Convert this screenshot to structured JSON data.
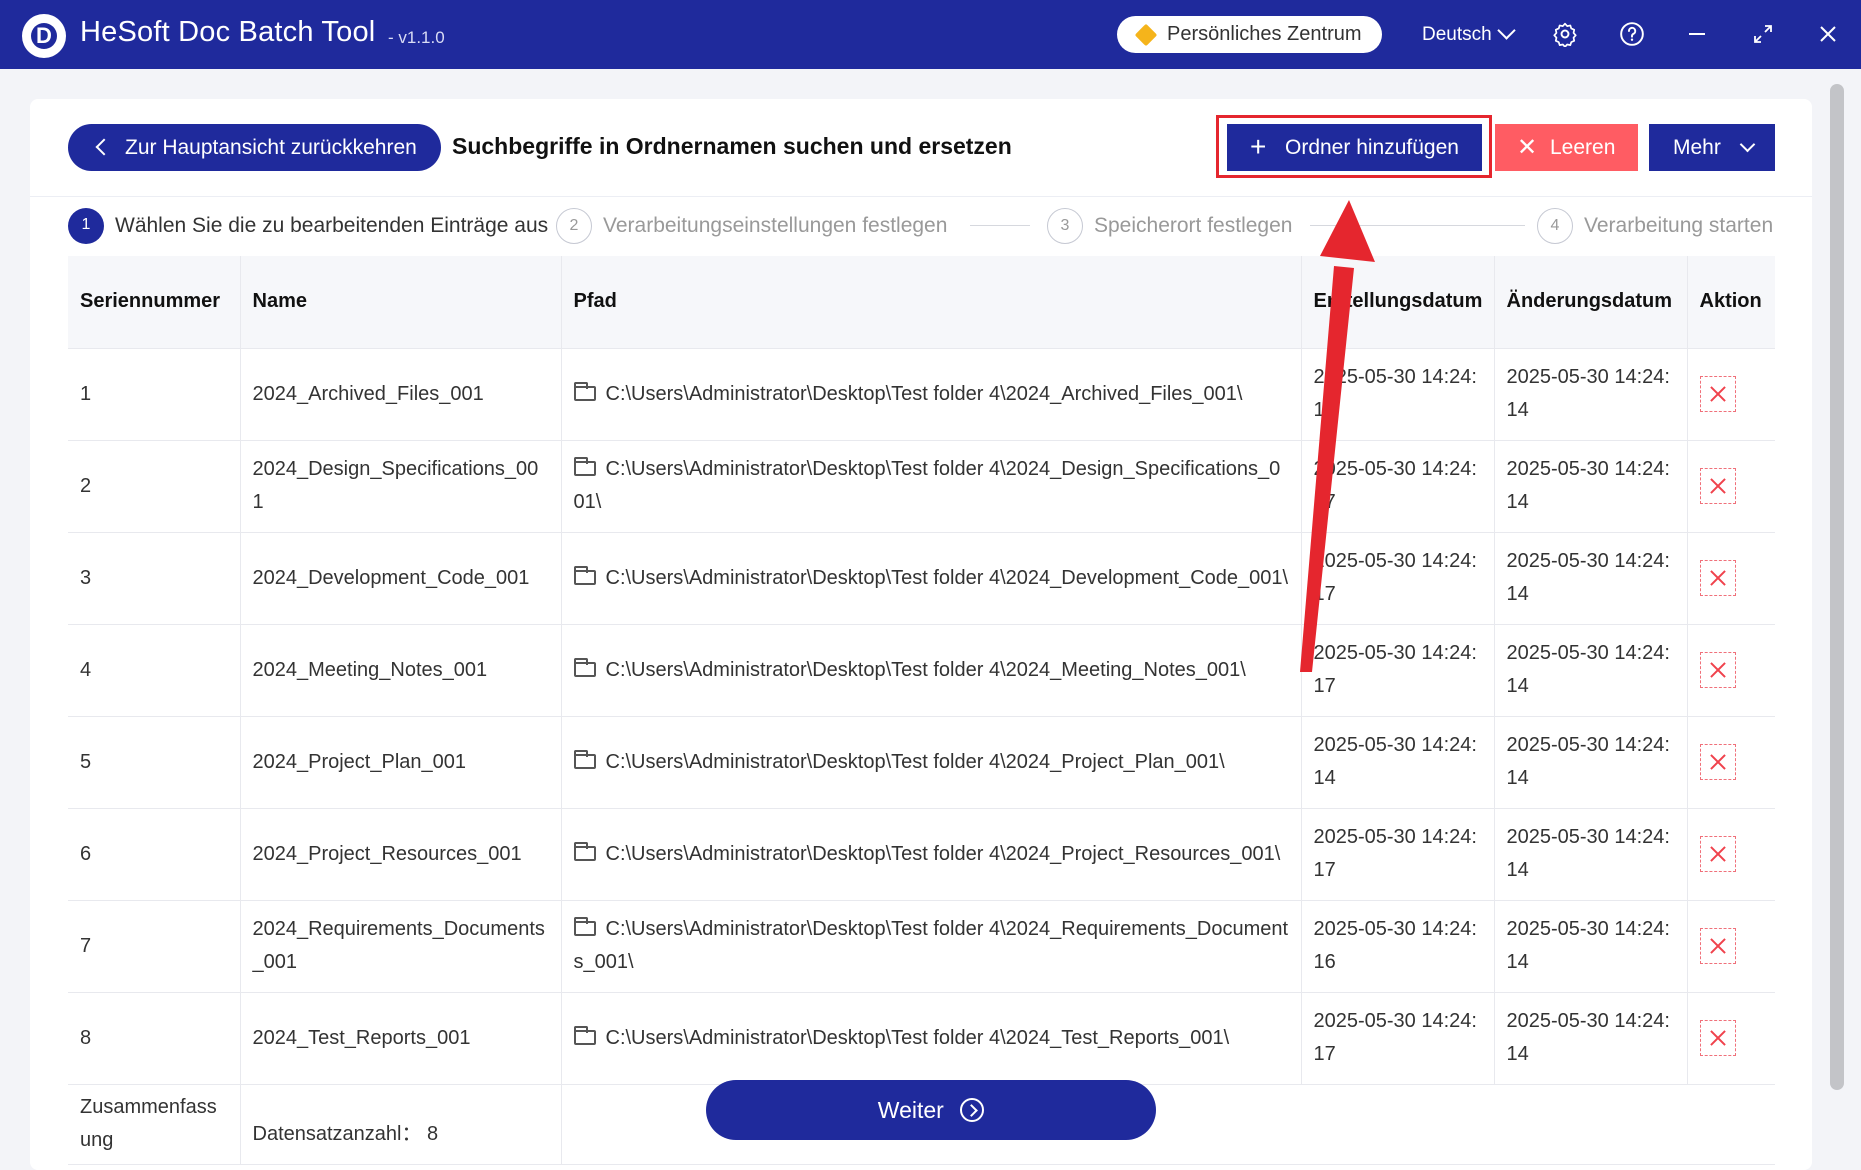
{
  "app": {
    "logo_letter": "D",
    "title": "HeSoft Doc Batch Tool",
    "version": "- v1.1.0",
    "personal_center": "Persönliches Zentrum",
    "language": "Deutsch"
  },
  "toolbar": {
    "back_label": "Zur Hauptansicht zurückkehren",
    "page_title": "Suchbegriffe in Ordnernamen suchen und ersetzen",
    "add_folder_label": "Ordner hinzufügen",
    "clear_label": "Leeren",
    "more_label": "Mehr"
  },
  "steps": [
    {
      "num": "1",
      "label": "Wählen Sie die zu bearbeitenden Einträge aus",
      "active": true
    },
    {
      "num": "2",
      "label": "Verarbeitungseinstellungen festlegen",
      "active": false
    },
    {
      "num": "3",
      "label": "Speicherort festlegen",
      "active": false
    },
    {
      "num": "4",
      "label": "Verarbeitung starten",
      "active": false
    }
  ],
  "table": {
    "headers": [
      "Seriennummer",
      "Name",
      "Pfad",
      "Erstellungsdatum",
      "Änderungsdatum",
      "Aktion"
    ],
    "rows": [
      {
        "id": "1",
        "name": "2024_Archived_Files_001",
        "path": "C:\\Users\\Administrator\\Desktop\\Test folder 4\\2024_Archived_Files_001\\",
        "created": "2025-05-30 14:24:18",
        "modified": "2025-05-30 14:24:14"
      },
      {
        "id": "2",
        "name": "2024_Design_Specifications_001",
        "path": "C:\\Users\\Administrator\\Desktop\\Test folder 4\\2024_Design_Specifications_001\\",
        "created": "2025-05-30 14:24:17",
        "modified": "2025-05-30 14:24:14"
      },
      {
        "id": "3",
        "name": "2024_Development_Code_001",
        "path": "C:\\Users\\Administrator\\Desktop\\Test folder 4\\2024_Development_Code_001\\",
        "created": "2025-05-30 14:24:17",
        "modified": "2025-05-30 14:24:14"
      },
      {
        "id": "4",
        "name": "2024_Meeting_Notes_001",
        "path": "C:\\Users\\Administrator\\Desktop\\Test folder 4\\2024_Meeting_Notes_001\\",
        "created": "2025-05-30 14:24:17",
        "modified": "2025-05-30 14:24:14"
      },
      {
        "id": "5",
        "name": "2024_Project_Plan_001",
        "path": "C:\\Users\\Administrator\\Desktop\\Test folder 4\\2024_Project_Plan_001\\",
        "created": "2025-05-30 14:24:14",
        "modified": "2025-05-30 14:24:14"
      },
      {
        "id": "6",
        "name": "2024_Project_Resources_001",
        "path": "C:\\Users\\Administrator\\Desktop\\Test folder 4\\2024_Project_Resources_001\\",
        "created": "2025-05-30 14:24:17",
        "modified": "2025-05-30 14:24:14"
      },
      {
        "id": "7",
        "name": "2024_Requirements_Documents_001",
        "path": "C:\\Users\\Administrator\\Desktop\\Test folder 4\\2024_Requirements_Documents_001\\",
        "created": "2025-05-30 14:24:16",
        "modified": "2025-05-30 14:24:14"
      },
      {
        "id": "8",
        "name": "2024_Test_Reports_001",
        "path": "C:\\Users\\Administrator\\Desktop\\Test folder 4\\2024_Test_Reports_001\\",
        "created": "2025-05-30 14:24:17",
        "modified": "2025-05-30 14:24:14"
      }
    ],
    "summary_label": "Zusammenfassung",
    "record_count": "Datensatzanzahl： 8"
  },
  "footer": {
    "next_label": "Weiter"
  },
  "colors": {
    "primary": "#1f2a9c",
    "danger": "#ff5c63",
    "annotation": "#e5262e"
  },
  "icons": [
    "gear-icon",
    "help-icon",
    "minimize-icon",
    "maximize-icon",
    "close-icon",
    "folder-icon",
    "delete-icon",
    "diamond-icon",
    "chevron-left-icon",
    "chevron-down-icon",
    "plus-icon",
    "arrow-right-circle-icon"
  ]
}
